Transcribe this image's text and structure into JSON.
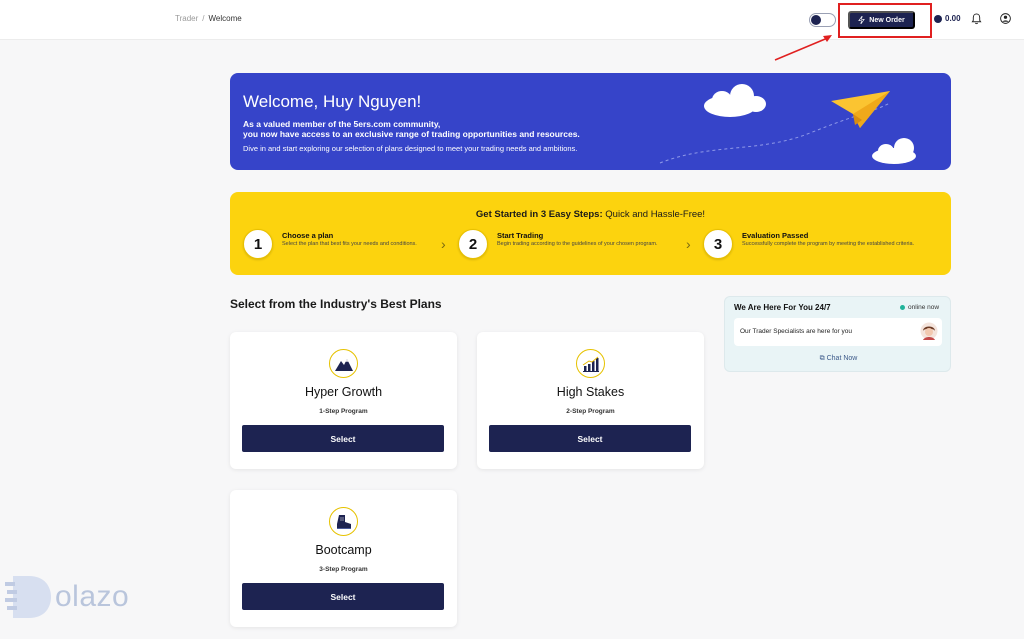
{
  "header": {
    "breadcrumb": {
      "parent": "Trader",
      "separator": "/",
      "current": "Welcome"
    },
    "new_order_label": "New Order",
    "balance": "0.00"
  },
  "welcome": {
    "title": "Welcome, Huy Nguyen!",
    "line1": "As a valued member of the 5ers.com community,",
    "line2": "you now have access to an exclusive range of trading opportunities and resources.",
    "line3": "Dive in and start exploring our selection of plans designed to meet your trading needs and ambitions."
  },
  "steps": {
    "heading_bold": "Get Started in 3 Easy Steps:",
    "heading_rest": "Quick and Hassle-Free!",
    "items": [
      {
        "num": "1",
        "title": "Choose a plan",
        "desc": "Select the plan that best fits your needs and conditions."
      },
      {
        "num": "2",
        "title": "Start Trading",
        "desc": "Begin trading according to the guidelines of your chosen program."
      },
      {
        "num": "3",
        "title": "Evaluation Passed",
        "desc": "Successfully complete the program by meeting the established criteria."
      }
    ]
  },
  "plans": {
    "title": "Select from the Industry's Best Plans",
    "items": [
      {
        "name": "Hyper Growth",
        "program": "1-Step Program",
        "button": "Select",
        "icon": "mountain-icon"
      },
      {
        "name": "High Stakes",
        "program": "2-Step Program",
        "button": "Select",
        "icon": "growth-chart-icon"
      },
      {
        "name": "Bootcamp",
        "program": "3-Step Program",
        "button": "Select",
        "icon": "boot-icon"
      }
    ]
  },
  "support": {
    "title": "We Are Here For You 24/7",
    "status": "online now",
    "message": "Our Trader Specialists are here for you",
    "chat_label": "Chat Now"
  },
  "watermark": {
    "text": "olazo"
  },
  "colors": {
    "navy": "#1d2351",
    "banner_blue": "#3644c9",
    "steps_yellow": "#fcd30e",
    "highlight_red": "#e02020",
    "online_green": "#20b39a"
  }
}
